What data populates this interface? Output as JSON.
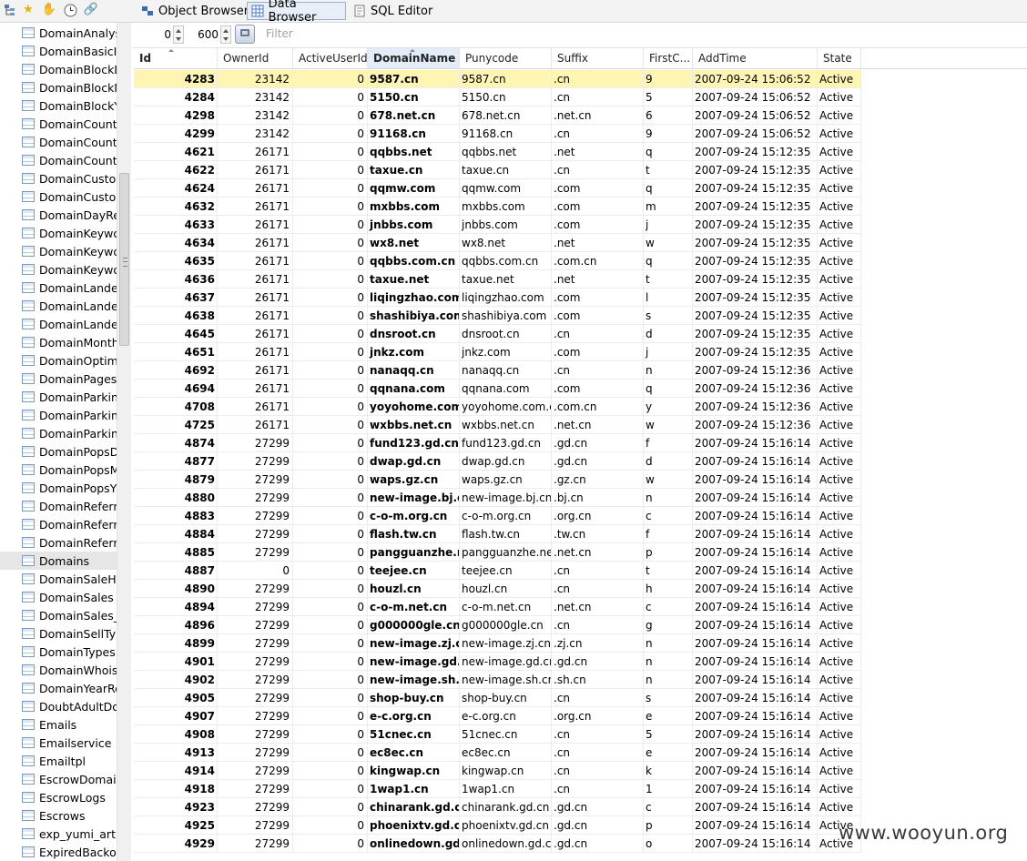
{
  "toolbar": {
    "icons": [
      "tree-icon",
      "star-icon",
      "hand-icon",
      "clock-icon",
      "link-icon"
    ],
    "tabs": [
      {
        "label": "Object Browser",
        "active": false
      },
      {
        "label": "Data Browser",
        "active": true
      },
      {
        "label": "SQL Editor",
        "active": false
      }
    ]
  },
  "sidebar": {
    "selected": "Domains",
    "items": [
      "DomainAnalys",
      "DomainBasicIr",
      "DomainBlockD",
      "DomainBlockM",
      "DomainBlockY",
      "DomainCountr",
      "DomainCountr",
      "DomainCountr",
      "DomainCustor",
      "DomainCustor",
      "DomainDayRe",
      "DomainKeywo",
      "DomainKeywo",
      "DomainKeywo",
      "DomainLander",
      "DomainLander",
      "DomainLander",
      "DomainMonth",
      "DomainOptimi",
      "DomainPages",
      "DomainParkin",
      "DomainParkin",
      "DomainParkin",
      "DomainPopsD",
      "DomainPopsM",
      "DomainPopsY",
      "DomainReferr",
      "DomainReferr",
      "DomainReferr",
      "Domains",
      "DomainSaleHi",
      "DomainSales",
      "DomainSales_",
      "DomainSellTyp",
      "DomainTypes",
      "DomainWhoisl",
      "DomainYearRe",
      "DoubtAdultDo",
      "Emails",
      "Emailservice",
      "Emailtpl",
      "EscrowDomair",
      "EscrowLogs",
      "Escrows",
      "exp_yumi_artic",
      "ExpiredBackor"
    ]
  },
  "filter": {
    "offset": "0",
    "limit": "600",
    "placeholder": "Filter"
  },
  "grid": {
    "columns": [
      "Id",
      "OwnerId",
      "ActiveUserId",
      "DomainName",
      "Punycode",
      "Suffix",
      "FirstC...",
      "AddTime",
      "State"
    ],
    "sorted_column": "DomainName",
    "highlight_row": 0,
    "rows": [
      [
        "4283",
        "23142",
        "0",
        "9587.cn",
        "9587.cn",
        ".cn",
        "9",
        "2007-09-24 15:06:52",
        "Active"
      ],
      [
        "4284",
        "23142",
        "0",
        "5150.cn",
        "5150.cn",
        ".cn",
        "5",
        "2007-09-24 15:06:52",
        "Active"
      ],
      [
        "4298",
        "23142",
        "0",
        "678.net.cn",
        "678.net.cn",
        ".net.cn",
        "6",
        "2007-09-24 15:06:52",
        "Active"
      ],
      [
        "4299",
        "23142",
        "0",
        "91168.cn",
        "91168.cn",
        ".cn",
        "9",
        "2007-09-24 15:06:52",
        "Active"
      ],
      [
        "4621",
        "26171",
        "0",
        "qqbbs.net",
        "qqbbs.net",
        ".net",
        "q",
        "2007-09-24 15:12:35",
        "Active"
      ],
      [
        "4622",
        "26171",
        "0",
        "taxue.cn",
        "taxue.cn",
        ".cn",
        "t",
        "2007-09-24 15:12:35",
        "Active"
      ],
      [
        "4624",
        "26171",
        "0",
        "qqmw.com",
        "qqmw.com",
        ".com",
        "q",
        "2007-09-24 15:12:35",
        "Active"
      ],
      [
        "4632",
        "26171",
        "0",
        "mxbbs.com",
        "mxbbs.com",
        ".com",
        "m",
        "2007-09-24 15:12:35",
        "Active"
      ],
      [
        "4633",
        "26171",
        "0",
        "jnbbs.com",
        "jnbbs.com",
        ".com",
        "j",
        "2007-09-24 15:12:35",
        "Active"
      ],
      [
        "4634",
        "26171",
        "0",
        "wx8.net",
        "wx8.net",
        ".net",
        "w",
        "2007-09-24 15:12:35",
        "Active"
      ],
      [
        "4635",
        "26171",
        "0",
        "qqbbs.com.cn",
        "qqbbs.com.cn",
        ".com.cn",
        "q",
        "2007-09-24 15:12:35",
        "Active"
      ],
      [
        "4636",
        "26171",
        "0",
        "taxue.net",
        "taxue.net",
        ".net",
        "t",
        "2007-09-24 15:12:35",
        "Active"
      ],
      [
        "4637",
        "26171",
        "0",
        "liqingzhao.com",
        "liqingzhao.com",
        ".com",
        "l",
        "2007-09-24 15:12:35",
        "Active"
      ],
      [
        "4638",
        "26171",
        "0",
        "shashibiya.com",
        "shashibiya.com",
        ".com",
        "s",
        "2007-09-24 15:12:35",
        "Active"
      ],
      [
        "4645",
        "26171",
        "0",
        "dnsroot.cn",
        "dnsroot.cn",
        ".cn",
        "d",
        "2007-09-24 15:12:35",
        "Active"
      ],
      [
        "4651",
        "26171",
        "0",
        "jnkz.com",
        "jnkz.com",
        ".com",
        "j",
        "2007-09-24 15:12:35",
        "Active"
      ],
      [
        "4692",
        "26171",
        "0",
        "nanaqq.cn",
        "nanaqq.cn",
        ".cn",
        "n",
        "2007-09-24 15:12:36",
        "Active"
      ],
      [
        "4694",
        "26171",
        "0",
        "qqnana.com",
        "qqnana.com",
        ".com",
        "q",
        "2007-09-24 15:12:36",
        "Active"
      ],
      [
        "4708",
        "26171",
        "0",
        "yoyohome.com",
        "yoyohome.com.cn",
        ".com.cn",
        "y",
        "2007-09-24 15:12:36",
        "Active"
      ],
      [
        "4725",
        "26171",
        "0",
        "wxbbs.net.cn",
        "wxbbs.net.cn",
        ".net.cn",
        "w",
        "2007-09-24 15:12:36",
        "Active"
      ],
      [
        "4874",
        "27299",
        "0",
        "fund123.gd.cn",
        "fund123.gd.cn",
        ".gd.cn",
        "f",
        "2007-09-24 15:16:14",
        "Active"
      ],
      [
        "4877",
        "27299",
        "0",
        "dwap.gd.cn",
        "dwap.gd.cn",
        ".gd.cn",
        "d",
        "2007-09-24 15:16:14",
        "Active"
      ],
      [
        "4879",
        "27299",
        "0",
        "waps.gz.cn",
        "waps.gz.cn",
        ".gz.cn",
        "w",
        "2007-09-24 15:16:14",
        "Active"
      ],
      [
        "4880",
        "27299",
        "0",
        "new-image.bj.c",
        "new-image.bj.cn",
        ".bj.cn",
        "n",
        "2007-09-24 15:16:14",
        "Active"
      ],
      [
        "4883",
        "27299",
        "0",
        "c-o-m.org.cn",
        "c-o-m.org.cn",
        ".org.cn",
        "c",
        "2007-09-24 15:16:14",
        "Active"
      ],
      [
        "4884",
        "27299",
        "0",
        "flash.tw.cn",
        "flash.tw.cn",
        ".tw.cn",
        "f",
        "2007-09-24 15:16:14",
        "Active"
      ],
      [
        "4885",
        "27299",
        "0",
        "pangguanzhe.n",
        "pangguanzhe.net",
        ".net.cn",
        "p",
        "2007-09-24 15:16:14",
        "Active"
      ],
      [
        "4887",
        "0",
        "0",
        "teejee.cn",
        "teejee.cn",
        ".cn",
        "t",
        "2007-09-24 15:16:14",
        "Active"
      ],
      [
        "4890",
        "27299",
        "0",
        "houzl.cn",
        "houzl.cn",
        ".cn",
        "h",
        "2007-09-24 15:16:14",
        "Active"
      ],
      [
        "4894",
        "27299",
        "0",
        "c-o-m.net.cn",
        "c-o-m.net.cn",
        ".net.cn",
        "c",
        "2007-09-24 15:16:14",
        "Active"
      ],
      [
        "4896",
        "27299",
        "0",
        "g000000gle.cn",
        "g000000gle.cn",
        ".cn",
        "g",
        "2007-09-24 15:16:14",
        "Active"
      ],
      [
        "4899",
        "27299",
        "0",
        "new-image.zj.c",
        "new-image.zj.cn",
        ".zj.cn",
        "n",
        "2007-09-24 15:16:14",
        "Active"
      ],
      [
        "4901",
        "27299",
        "0",
        "new-image.gd.",
        "new-image.gd.cn",
        ".gd.cn",
        "n",
        "2007-09-24 15:16:14",
        "Active"
      ],
      [
        "4902",
        "27299",
        "0",
        "new-image.sh.",
        "new-image.sh.cn",
        ".sh.cn",
        "n",
        "2007-09-24 15:16:14",
        "Active"
      ],
      [
        "4905",
        "27299",
        "0",
        "shop-buy.cn",
        "shop-buy.cn",
        ".cn",
        "s",
        "2007-09-24 15:16:14",
        "Active"
      ],
      [
        "4907",
        "27299",
        "0",
        "e-c.org.cn",
        "e-c.org.cn",
        ".org.cn",
        "e",
        "2007-09-24 15:16:14",
        "Active"
      ],
      [
        "4908",
        "27299",
        "0",
        "51cnec.cn",
        "51cnec.cn",
        ".cn",
        "5",
        "2007-09-24 15:16:14",
        "Active"
      ],
      [
        "4913",
        "27299",
        "0",
        "ec8ec.cn",
        "ec8ec.cn",
        ".cn",
        "e",
        "2007-09-24 15:16:14",
        "Active"
      ],
      [
        "4914",
        "27299",
        "0",
        "kingwap.cn",
        "kingwap.cn",
        ".cn",
        "k",
        "2007-09-24 15:16:14",
        "Active"
      ],
      [
        "4918",
        "27299",
        "0",
        "1wap1.cn",
        "1wap1.cn",
        ".cn",
        "1",
        "2007-09-24 15:16:14",
        "Active"
      ],
      [
        "4923",
        "27299",
        "0",
        "chinarank.gd.c",
        "chinarank.gd.cn",
        ".gd.cn",
        "c",
        "2007-09-24 15:16:14",
        "Active"
      ],
      [
        "4925",
        "27299",
        "0",
        "phoenixtv.gd.c",
        "phoenixtv.gd.cn",
        ".gd.cn",
        "p",
        "2007-09-24 15:16:14",
        "Active"
      ],
      [
        "4929",
        "27299",
        "0",
        "onlinedown.gd.",
        "onlinedown.gd.cn",
        ".gd.cn",
        "o",
        "2007-09-24 15:16:14",
        "Active"
      ]
    ]
  },
  "watermark": "www.wooyun.org",
  "colors": {
    "highlight": "#fff5b3",
    "sorted_header": "#e4ecf7",
    "active_tab": "#e8eef8"
  }
}
